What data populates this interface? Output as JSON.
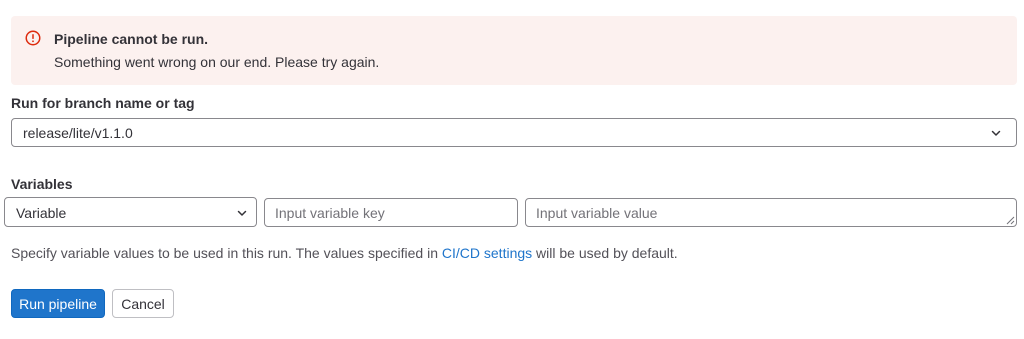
{
  "alert": {
    "title": "Pipeline cannot be run.",
    "message": "Something went wrong on our end. Please try again.",
    "icon": "error-icon",
    "color": "#dd2b0e"
  },
  "branch": {
    "label": "Run for branch name or tag",
    "selected": "release/lite/v1.1.0"
  },
  "variables": {
    "label": "Variables",
    "type_selected": "Variable",
    "key_placeholder": "Input variable key",
    "value_placeholder": "Input variable value"
  },
  "help": {
    "prefix": "Specify variable values to be used in this run. The values specified in ",
    "link": "CI/CD settings",
    "suffix": " will be used by default."
  },
  "actions": {
    "run_label": "Run pipeline",
    "cancel_label": "Cancel",
    "primary_color": "#1f75cb"
  }
}
